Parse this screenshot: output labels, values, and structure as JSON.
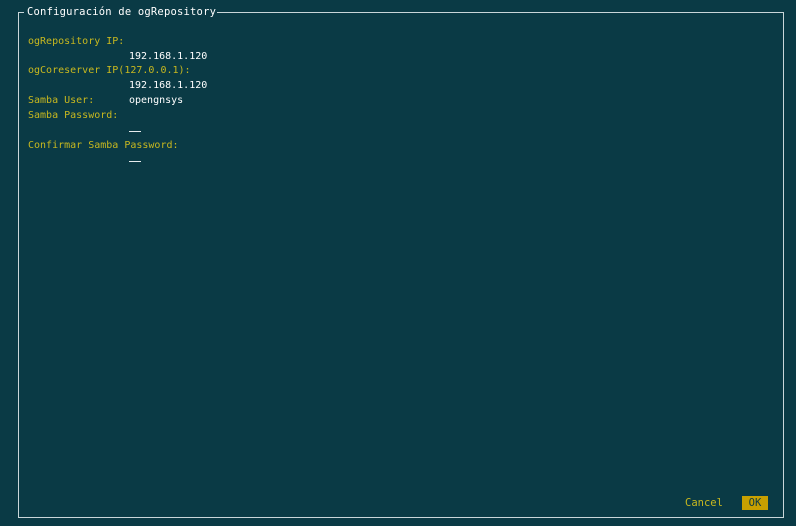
{
  "dialog": {
    "title": "Configuración de ogRepository"
  },
  "fields": {
    "repo_ip_label": "ogRepository IP:",
    "repo_ip_value": "192.168.1.120",
    "core_ip_label": "ogCoreserver IP(127.0.0.1):",
    "core_ip_value": "192.168.1.120",
    "samba_user_label": "Samba User:",
    "samba_user_value": "opengnsys",
    "samba_password_label": "Samba Password:",
    "confirm_password_label": "Confirmar Samba Password:"
  },
  "buttons": {
    "cancel_label": "Cancel",
    "ok_label": "OK"
  },
  "colors": {
    "background": "#0a3a45",
    "label": "#c8b81f",
    "value": "#ffffff",
    "ok_button": "#c8a000"
  }
}
